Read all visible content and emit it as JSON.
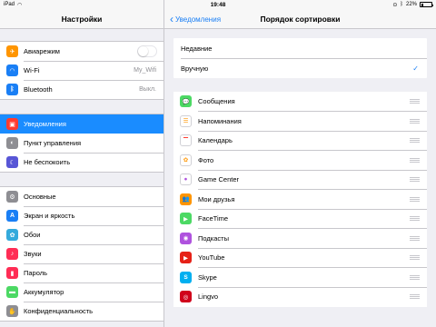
{
  "status_bar": {
    "device": "iPad",
    "time": "19:48",
    "battery": "22%",
    "battery_fraction": 0.22
  },
  "sidebar": {
    "title": "Настройки",
    "groups": [
      [
        {
          "label": "Авиарежим",
          "icon": "airplane-icon",
          "color": "#ff9500",
          "glyph": "✈",
          "control": "toggle",
          "toggle_on": false
        },
        {
          "label": "Wi-Fi",
          "icon": "wifi-icon",
          "color": "#1a7ff5",
          "glyph": "◠",
          "value": "My_Wifi"
        },
        {
          "label": "Bluetooth",
          "icon": "bluetooth-icon",
          "color": "#1a7ff5",
          "glyph": "ᛒ",
          "value": "Выкл."
        }
      ],
      [
        {
          "label": "Уведомления",
          "icon": "notifications-icon",
          "color": "#ff3b30",
          "glyph": "▣",
          "selected": true
        },
        {
          "label": "Пункт управления",
          "icon": "control-center-icon",
          "color": "#8e8e93",
          "glyph": "◐"
        },
        {
          "label": "Не беспокоить",
          "icon": "moon-icon",
          "color": "#5856d6",
          "glyph": "☾"
        }
      ],
      [
        {
          "label": "Основные",
          "icon": "gear-icon",
          "color": "#8e8e93",
          "glyph": "⚙"
        },
        {
          "label": "Экран и яркость",
          "icon": "display-icon",
          "color": "#1a7ff5",
          "glyph": "A"
        },
        {
          "label": "Обои",
          "icon": "wallpaper-icon",
          "color": "#34aadc",
          "glyph": "✿"
        },
        {
          "label": "Звуки",
          "icon": "sound-icon",
          "color": "#ff2d55",
          "glyph": "♪"
        },
        {
          "label": "Пароль",
          "icon": "lock-icon",
          "color": "#ff2d55",
          "glyph": "▮"
        },
        {
          "label": "Аккумулятор",
          "icon": "battery-icon",
          "color": "#4cd964",
          "glyph": "▬"
        },
        {
          "label": "Конфиденциальность",
          "icon": "hand-icon",
          "color": "#8e8e93",
          "glyph": "✋"
        }
      ]
    ]
  },
  "detail": {
    "back_label": "Уведомления",
    "title": "Порядок сортировки",
    "sort_options": [
      {
        "label": "Недавние",
        "checked": false
      },
      {
        "label": "Вручную",
        "checked": true
      }
    ],
    "apps": [
      {
        "label": "Сообщения",
        "icon": "messages-icon",
        "color": "#4cd964",
        "glyph": "💬"
      },
      {
        "label": "Напоминания",
        "icon": "reminders-icon",
        "color": "#ffffff",
        "glyph": "☰",
        "glyph_color": "#ff9500"
      },
      {
        "label": "Календарь",
        "icon": "calendar-icon",
        "color": "#ffffff",
        "glyph": "▔",
        "glyph_color": "#ff3b30"
      },
      {
        "label": "Фото",
        "icon": "photos-icon",
        "color": "#ffffff",
        "glyph": "✿",
        "glyph_color": "#ff9500"
      },
      {
        "label": "Game Center",
        "icon": "game-center-icon",
        "color": "#ffffff",
        "glyph": "●",
        "glyph_color": "#af52de"
      },
      {
        "label": "Мои друзья",
        "icon": "find-friends-icon",
        "color": "#ff9500",
        "glyph": "👥"
      },
      {
        "label": "FaceTime",
        "icon": "facetime-icon",
        "color": "#4cd964",
        "glyph": "▶"
      },
      {
        "label": "Подкасты",
        "icon": "podcasts-icon",
        "color": "#af52de",
        "glyph": "◉"
      },
      {
        "label": "YouTube",
        "icon": "youtube-icon",
        "color": "#e62117",
        "glyph": "▶"
      },
      {
        "label": "Skype",
        "icon": "skype-icon",
        "color": "#00aff0",
        "glyph": "S"
      },
      {
        "label": "Lingvo",
        "icon": "lingvo-icon",
        "color": "#d0021b",
        "glyph": "◎"
      }
    ]
  }
}
